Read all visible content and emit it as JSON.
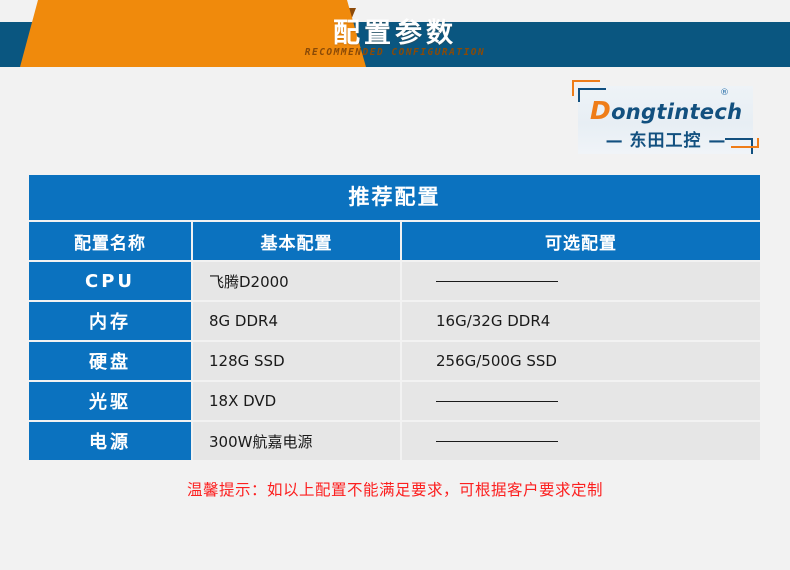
{
  "banner": {
    "title": "配置参数",
    "subtitle": "RECOMMENDED CONFIGURATION",
    "orange": "#f08a0c",
    "dark_blue": "#0a5680",
    "fold_brown": "#8c4a09"
  },
  "logo": {
    "brand_initial": "D",
    "brand_rest": "ongtintech",
    "registered": "®",
    "chinese": "东田工控",
    "dash_left": "—",
    "dash_right": "—",
    "accent_orange": "#ef7d18",
    "accent_blue": "#12507f"
  },
  "table": {
    "title": "推荐配置",
    "headers": [
      "配置名称",
      "基本配置",
      "可选配置"
    ],
    "rows": [
      {
        "name": "CPU",
        "basic": "飞腾D2000",
        "optional": "",
        "optional_is_dash": true
      },
      {
        "name": "内存",
        "basic": "8G DDR4",
        "optional": "16G/32G DDR4",
        "optional_is_dash": false
      },
      {
        "name": "硬盘",
        "basic": "128G SSD",
        "optional": "256G/500G SSD",
        "optional_is_dash": false
      },
      {
        "name": "光驱",
        "basic": "18X DVD",
        "optional": "",
        "optional_is_dash": true
      },
      {
        "name": "电源",
        "basic": "300W航嘉电源",
        "optional": "",
        "optional_is_dash": true
      }
    ],
    "header_blue": "#0b72bf",
    "cell_gray": "#e6e6e6"
  },
  "footer": {
    "note": "温馨提示：如以上配置不能满足要求，可根据客户要求定制",
    "color": "#fc1f1f"
  }
}
